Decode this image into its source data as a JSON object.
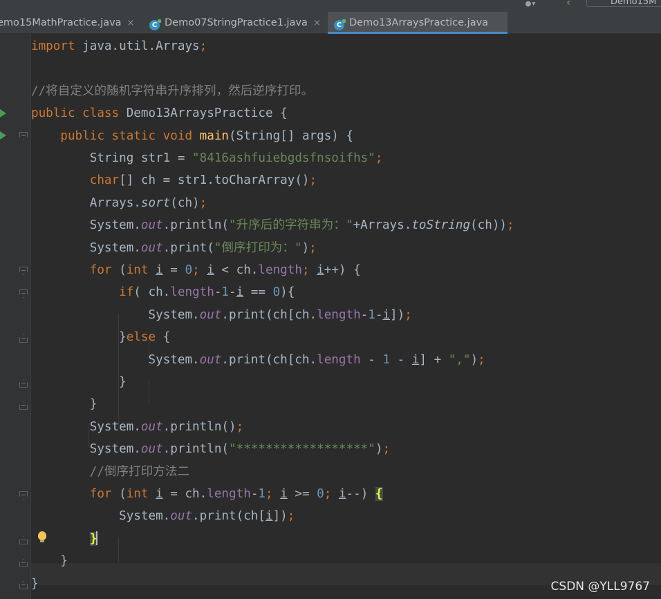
{
  "header": {
    "run_config_label": "Demo15M"
  },
  "tabs": [
    {
      "label": "emo15MathPractice.java",
      "close": "×",
      "active": false,
      "has_icon": false
    },
    {
      "label": "Demo07StringPractice1.java",
      "close": "×",
      "active": false,
      "has_icon": true
    },
    {
      "label": "Demo13ArraysPractice.java",
      "close": "×",
      "active": true,
      "has_icon": true
    }
  ],
  "icons": {
    "tab_file_icon": "java-class-icon",
    "run_icon": "run-play-icon",
    "fold_icon": "fold-marker-icon",
    "bulb_icon": "intention-bulb-icon"
  },
  "colors": {
    "editor_bg": "#2b2b2b",
    "keyword": "#cc7832",
    "string": "#6a8759",
    "number": "#6897bb",
    "comment": "#808080",
    "field": "#9876aa",
    "method_decl": "#ffc66d",
    "default_text": "#a9b7c6",
    "active_tab_underline": "#4a88c7"
  },
  "code": {
    "lines": [
      {
        "segments": [
          {
            "t": "import",
            "c": "kw"
          },
          {
            "t": " java.util.Arrays"
          },
          {
            "t": ";",
            "c": "kw"
          }
        ]
      },
      {
        "segments": []
      },
      {
        "segments": [
          {
            "t": "//将自定义的随机字符串升序排列，然后逆序打印。",
            "c": "cmt"
          }
        ]
      },
      {
        "segments": [
          {
            "t": "public class ",
            "c": "kw"
          },
          {
            "t": "Demo13ArraysPractice {"
          }
        ]
      },
      {
        "segments": [
          {
            "t": "    "
          },
          {
            "t": "public static void ",
            "c": "kw"
          },
          {
            "t": "main",
            "c": "fn"
          },
          {
            "t": "(String[] args) {"
          }
        ]
      },
      {
        "segments": [
          {
            "t": "        String str1 = "
          },
          {
            "t": "\"8416ashfuiebgdsfnsoifhs\"",
            "c": "str"
          },
          {
            "t": ";",
            "c": "kw"
          }
        ]
      },
      {
        "segments": [
          {
            "t": "        "
          },
          {
            "t": "char",
            "c": "kw"
          },
          {
            "t": "[] ch = str1.toCharArray()"
          },
          {
            "t": ";",
            "c": "kw"
          }
        ]
      },
      {
        "segments": [
          {
            "t": "        Arrays."
          },
          {
            "t": "sort",
            "c": "ital"
          },
          {
            "t": "(ch)"
          },
          {
            "t": ";",
            "c": "kw"
          }
        ]
      },
      {
        "segments": [
          {
            "t": "        System."
          },
          {
            "t": "out",
            "c": "fld ital"
          },
          {
            "t": ".println("
          },
          {
            "t": "\"升序后的字符串为：\"",
            "c": "str"
          },
          {
            "t": "+Arrays."
          },
          {
            "t": "toString",
            "c": "ital"
          },
          {
            "t": "(ch))"
          },
          {
            "t": ";",
            "c": "kw"
          }
        ]
      },
      {
        "segments": [
          {
            "t": "        System."
          },
          {
            "t": "out",
            "c": "fld ital"
          },
          {
            "t": ".print("
          },
          {
            "t": "\"倒序打印为：\"",
            "c": "str"
          },
          {
            "t": ")"
          },
          {
            "t": ";",
            "c": "kw"
          }
        ]
      },
      {
        "segments": [
          {
            "t": "        "
          },
          {
            "t": "for ",
            "c": "kw"
          },
          {
            "t": "("
          },
          {
            "t": "int ",
            "c": "kw"
          },
          {
            "t": "i",
            "c": "u"
          },
          {
            "t": " = "
          },
          {
            "t": "0",
            "c": "num"
          },
          {
            "t": "; ",
            "c": "kw"
          },
          {
            "t": "i",
            "c": "u"
          },
          {
            "t": " < ch."
          },
          {
            "t": "length",
            "c": "fld"
          },
          {
            "t": "; ",
            "c": "kw"
          },
          {
            "t": "i",
            "c": "u"
          },
          {
            "t": "++) {"
          }
        ]
      },
      {
        "segments": [
          {
            "t": "            "
          },
          {
            "t": "if",
            "c": "kw"
          },
          {
            "t": "( ch."
          },
          {
            "t": "length",
            "c": "fld"
          },
          {
            "t": "-"
          },
          {
            "t": "1",
            "c": "num"
          },
          {
            "t": "-"
          },
          {
            "t": "i",
            "c": "u"
          },
          {
            "t": " == "
          },
          {
            "t": "0",
            "c": "num"
          },
          {
            "t": "){"
          }
        ]
      },
      {
        "segments": [
          {
            "t": "                System."
          },
          {
            "t": "out",
            "c": "fld ital"
          },
          {
            "t": ".print(ch[ch."
          },
          {
            "t": "length",
            "c": "fld"
          },
          {
            "t": "-"
          },
          {
            "t": "1",
            "c": "num"
          },
          {
            "t": "-"
          },
          {
            "t": "i",
            "c": "u"
          },
          {
            "t": "])"
          },
          {
            "t": ";",
            "c": "kw"
          }
        ]
      },
      {
        "segments": [
          {
            "t": "            }"
          },
          {
            "t": "else ",
            "c": "kw"
          },
          {
            "t": "{"
          }
        ]
      },
      {
        "segments": [
          {
            "t": "                System."
          },
          {
            "t": "out",
            "c": "fld ital"
          },
          {
            "t": ".print(ch[ch."
          },
          {
            "t": "length",
            "c": "fld"
          },
          {
            "t": " - "
          },
          {
            "t": "1",
            "c": "num"
          },
          {
            "t": " - "
          },
          {
            "t": "i",
            "c": "u"
          },
          {
            "t": "] + "
          },
          {
            "t": "\",\"",
            "c": "str"
          },
          {
            "t": ")"
          },
          {
            "t": ";",
            "c": "kw"
          }
        ]
      },
      {
        "segments": [
          {
            "t": "            }"
          }
        ]
      },
      {
        "segments": [
          {
            "t": "        }"
          }
        ]
      },
      {
        "segments": [
          {
            "t": "        System."
          },
          {
            "t": "out",
            "c": "fld ital"
          },
          {
            "t": ".println()"
          },
          {
            "t": ";",
            "c": "kw"
          }
        ]
      },
      {
        "segments": [
          {
            "t": "        System."
          },
          {
            "t": "out",
            "c": "fld ital"
          },
          {
            "t": ".println("
          },
          {
            "t": "\"******************\"",
            "c": "str"
          },
          {
            "t": ")"
          },
          {
            "t": ";",
            "c": "kw"
          }
        ]
      },
      {
        "segments": [
          {
            "t": "        "
          },
          {
            "t": "//倒序打印方法二",
            "c": "cmt"
          }
        ]
      },
      {
        "segments": [
          {
            "t": "        "
          },
          {
            "t": "for ",
            "c": "kw"
          },
          {
            "t": "("
          },
          {
            "t": "int ",
            "c": "kw"
          },
          {
            "t": "i",
            "c": "u"
          },
          {
            "t": " = ch."
          },
          {
            "t": "length",
            "c": "fld"
          },
          {
            "t": "-"
          },
          {
            "t": "1",
            "c": "num"
          },
          {
            "t": "; ",
            "c": "kw"
          },
          {
            "t": "i",
            "c": "u"
          },
          {
            "t": " >= "
          },
          {
            "t": "0",
            "c": "num"
          },
          {
            "t": "; ",
            "c": "kw"
          },
          {
            "t": "i",
            "c": "u"
          },
          {
            "t": "--) "
          },
          {
            "t": "{",
            "c": "brace-hl"
          }
        ]
      },
      {
        "segments": [
          {
            "t": "            System."
          },
          {
            "t": "out",
            "c": "fld ital"
          },
          {
            "t": ".print(ch["
          },
          {
            "t": "i",
            "c": "u"
          },
          {
            "t": "])"
          },
          {
            "t": ";",
            "c": "kw"
          }
        ]
      },
      {
        "segments": [
          {
            "t": "        "
          },
          {
            "t": "}",
            "c": "brace-hl caret-after"
          }
        ]
      },
      {
        "segments": [
          {
            "t": "    }"
          }
        ]
      },
      {
        "segments": [
          {
            "t": "}"
          }
        ]
      }
    ]
  },
  "watermark": "CSDN @YLL9767"
}
